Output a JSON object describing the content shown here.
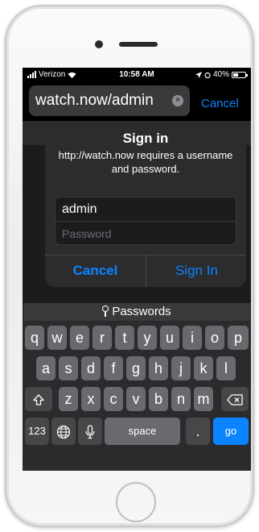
{
  "status": {
    "carrier": "Verizon",
    "time": "10:58 AM",
    "battery": "40%",
    "battery_level": 0.4
  },
  "browser": {
    "url": "watch.now/admin",
    "cancel_label": "Cancel"
  },
  "dialog": {
    "title": "Sign in",
    "message": "http://watch.now requires a username and password.",
    "username_value": "admin",
    "password_placeholder": "Password",
    "cancel_label": "Cancel",
    "signin_label": "Sign In"
  },
  "keyboard": {
    "passwords_label": "Passwords",
    "row1": [
      "q",
      "w",
      "e",
      "r",
      "t",
      "y",
      "u",
      "i",
      "o",
      "p"
    ],
    "row2": [
      "a",
      "s",
      "d",
      "f",
      "g",
      "h",
      "j",
      "k",
      "l"
    ],
    "row3": [
      "z",
      "x",
      "c",
      "v",
      "b",
      "n",
      "m"
    ],
    "numbers_label": "123",
    "space_label": "space",
    "period_label": ".",
    "go_label": "go"
  },
  "icons": [
    "wifi-icon",
    "location-icon",
    "alarm-icon",
    "battery-icon",
    "clear-icon",
    "key-icon",
    "shift-icon",
    "delete-icon",
    "globe-icon",
    "mic-icon"
  ]
}
